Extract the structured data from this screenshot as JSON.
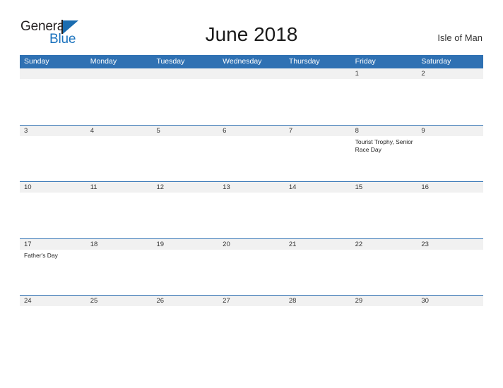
{
  "brand": {
    "name_part1": "General",
    "name_part2": "Blue",
    "flag_color": "#1a6cb0",
    "text_color": "#231f20",
    "blue_text_color": "#1a72bd"
  },
  "header": {
    "title": "June 2018",
    "locale": "Isle of Man"
  },
  "theme": {
    "header_blue": "#2f71b3",
    "band_gray": "#f1f1f1",
    "body_white": "#ffffff"
  },
  "calendar": {
    "weekdays": [
      "Sunday",
      "Monday",
      "Tuesday",
      "Wednesday",
      "Thursday",
      "Friday",
      "Saturday"
    ],
    "weeks": [
      {
        "days": [
          {
            "num": "",
            "event": ""
          },
          {
            "num": "",
            "event": ""
          },
          {
            "num": "",
            "event": ""
          },
          {
            "num": "",
            "event": ""
          },
          {
            "num": "",
            "event": ""
          },
          {
            "num": "1",
            "event": ""
          },
          {
            "num": "2",
            "event": ""
          }
        ]
      },
      {
        "days": [
          {
            "num": "3",
            "event": ""
          },
          {
            "num": "4",
            "event": ""
          },
          {
            "num": "5",
            "event": ""
          },
          {
            "num": "6",
            "event": ""
          },
          {
            "num": "7",
            "event": ""
          },
          {
            "num": "8",
            "event": "Tourist Trophy, Senior Race Day"
          },
          {
            "num": "9",
            "event": ""
          }
        ]
      },
      {
        "days": [
          {
            "num": "10",
            "event": ""
          },
          {
            "num": "11",
            "event": ""
          },
          {
            "num": "12",
            "event": ""
          },
          {
            "num": "13",
            "event": ""
          },
          {
            "num": "14",
            "event": ""
          },
          {
            "num": "15",
            "event": ""
          },
          {
            "num": "16",
            "event": ""
          }
        ]
      },
      {
        "days": [
          {
            "num": "17",
            "event": "Father's Day"
          },
          {
            "num": "18",
            "event": ""
          },
          {
            "num": "19",
            "event": ""
          },
          {
            "num": "20",
            "event": ""
          },
          {
            "num": "21",
            "event": ""
          },
          {
            "num": "22",
            "event": ""
          },
          {
            "num": "23",
            "event": ""
          }
        ]
      },
      {
        "days": [
          {
            "num": "24",
            "event": ""
          },
          {
            "num": "25",
            "event": ""
          },
          {
            "num": "26",
            "event": ""
          },
          {
            "num": "27",
            "event": ""
          },
          {
            "num": "28",
            "event": ""
          },
          {
            "num": "29",
            "event": ""
          },
          {
            "num": "30",
            "event": ""
          }
        ]
      }
    ]
  }
}
